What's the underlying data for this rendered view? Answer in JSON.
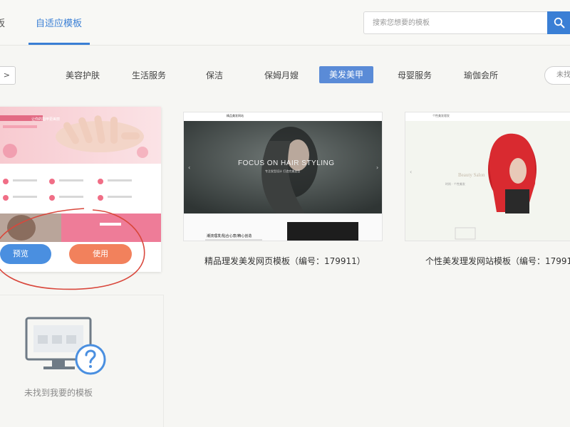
{
  "nav": {
    "prev_tab": "板",
    "active_tab": "自适应模板"
  },
  "search": {
    "placeholder": "搜索您想要的模板"
  },
  "categories": {
    "arrow": ">",
    "items": [
      "美容护肤",
      "生活服务",
      "保洁",
      "保姆月嫂",
      "美发美甲",
      "母婴服务",
      "瑜伽会所"
    ],
    "active": "美发美甲",
    "more": "未找"
  },
  "cards": [
    {
      "preview_label": "预览",
      "use_label": "使用",
      "banner_text": "让你的指甲更美丽"
    },
    {
      "title": "精品理发美发网页模板（编号：179911）",
      "hero_text": "FOCUS ON HAIR STYLING",
      "hero_sub": "专注发型设计 打造完美造型",
      "brand": "精品美发网站",
      "sub_heading": "潮流理发/贴合心意/精心创造"
    },
    {
      "title": "个性美发理发网站模板（编号：17991",
      "hero_text": "Beauty Salon",
      "hero_sub": "时尚 · 个性美发",
      "brand": "个性美发理发"
    }
  ],
  "empty_state": {
    "text": "未找到我要的模板"
  },
  "colors": {
    "accent": "#3a7fd5",
    "category_active": "#5a8bd7",
    "preview_button": "#4a8fe0",
    "use_button": "#f2815c",
    "annotation_circle": "#d9473c"
  }
}
